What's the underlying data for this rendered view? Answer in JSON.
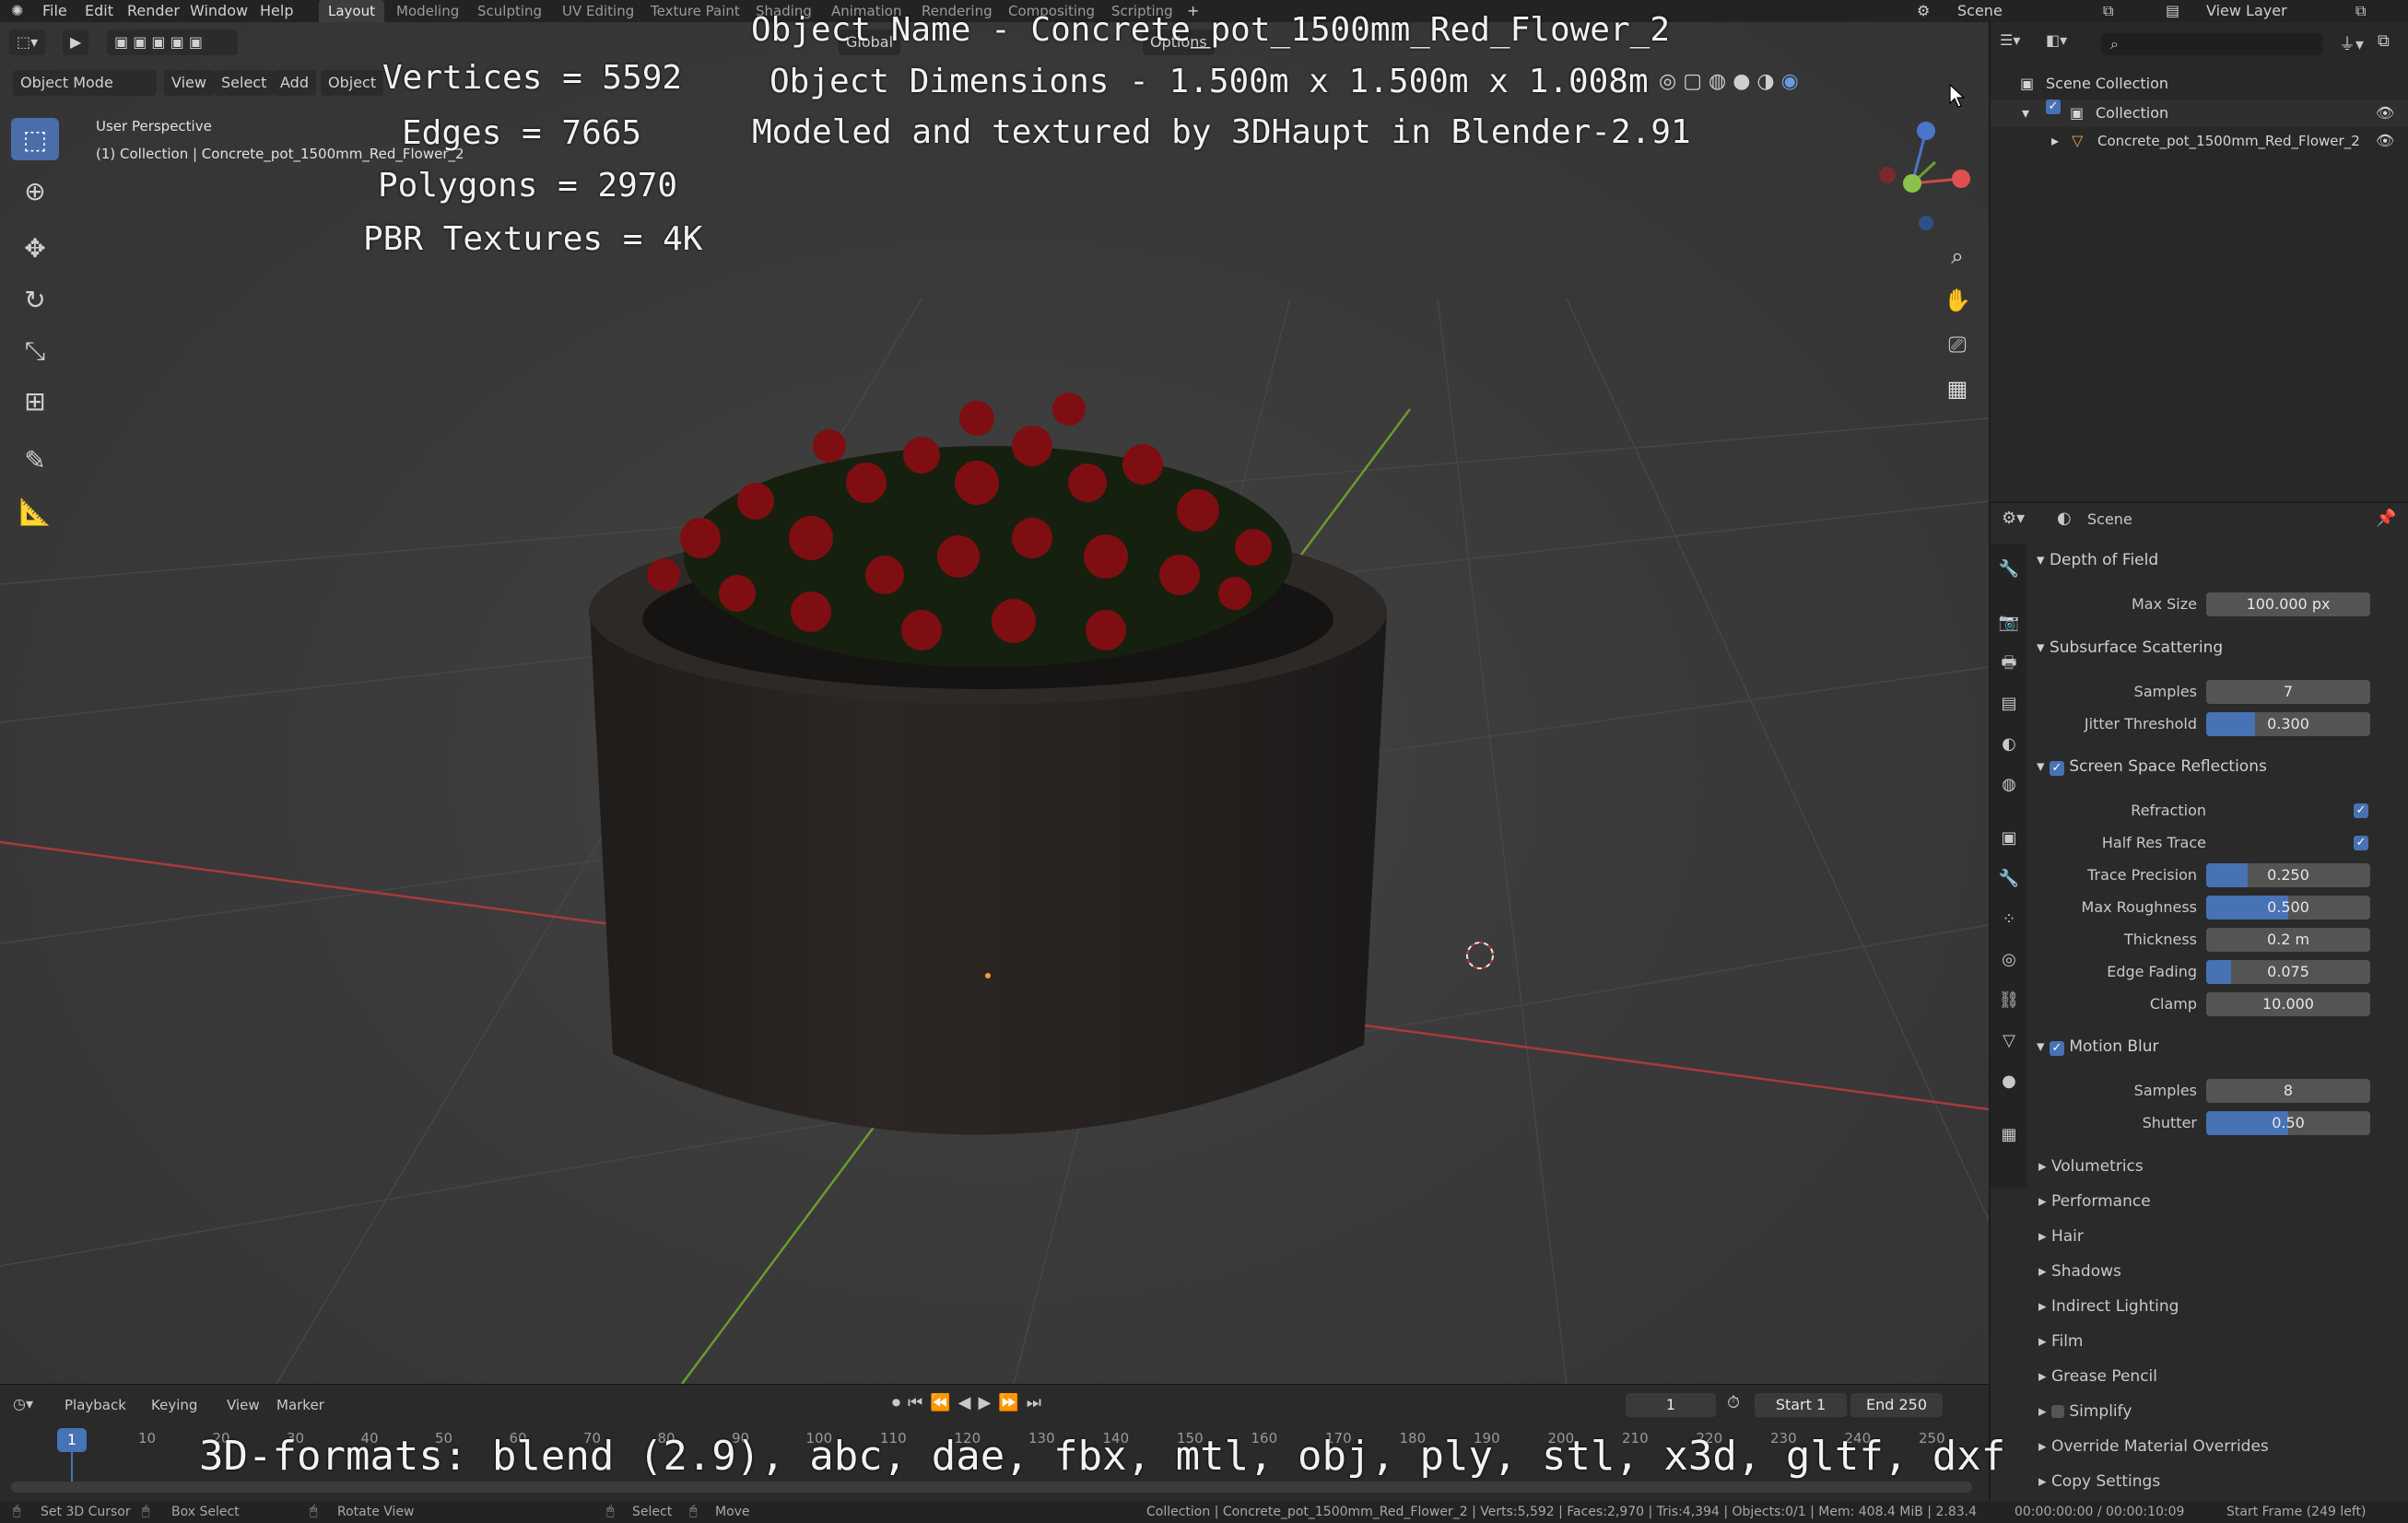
{
  "menu": [
    "File",
    "Edit",
    "Render",
    "Window",
    "Help"
  ],
  "workspaces": [
    "Layout",
    "Modeling",
    "Sculpting",
    "UV Editing",
    "Texture Paint",
    "Shading",
    "Animation",
    "Rendering",
    "Compositing",
    "Scripting"
  ],
  "scene_name": "Scene",
  "view_layer": "View Layer",
  "viewport": {
    "mode": "Object Mode",
    "header_menus": [
      "View",
      "Select",
      "Add",
      "Object"
    ],
    "orientation": "Global",
    "options_label": "Options",
    "perspective": "User Perspective",
    "collection_label": "(1) Collection | Concrete_pot_1500mm_Red_Flower_2"
  },
  "overlay": {
    "object_name": "Object Name - Concrete_pot_1500mm_Red_Flower_2",
    "dimensions": "Object Dimensions -  1.500m x 1.500m x 1.008m",
    "credit": "Modeled and textured by 3DHaupt in Blender-2.91",
    "vertices": "Vertices = 5592",
    "edges": "Edges = 7665",
    "polygons": "Polygons = 2970",
    "textures": "PBR Textures = 4K",
    "formats": "3D-formats: blend (2.9), abc, dae, fbx, mtl, obj, ply, stl, x3d, gltf, dxf"
  },
  "outliner": {
    "root": "Scene Collection",
    "collection": "Collection",
    "object": "Concrete_pot_1500mm_Red_Flower_2"
  },
  "properties": {
    "context": "Scene",
    "dof": {
      "title": "Depth of Field",
      "max_size_label": "Max Size",
      "max_size": "100.000 px"
    },
    "sss": {
      "title": "Subsurface Scattering",
      "samples_label": "Samples",
      "samples": "7",
      "jitter_label": "Jitter Threshold",
      "jitter": "0.300",
      "jitter_frac": 0.3
    },
    "ssr": {
      "title": "Screen Space Reflections",
      "refraction": "Refraction",
      "half_res": "Half Res Trace",
      "trace_label": "Trace Precision",
      "trace": "0.250",
      "trace_frac": 0.25,
      "rough_label": "Max Roughness",
      "rough": "0.500",
      "rough_frac": 0.5,
      "thick_label": "Thickness",
      "thick": "0.2 m",
      "fade_label": "Edge Fading",
      "fade": "0.075",
      "fade_frac": 0.15,
      "clamp_label": "Clamp",
      "clamp": "10.000"
    },
    "mblur": {
      "title": "Motion Blur",
      "samples_label": "Samples",
      "samples": "8",
      "shutter_label": "Shutter",
      "shutter": "0.50",
      "shutter_frac": 0.5
    },
    "collapsed": [
      "Volumetrics",
      "Performance",
      "Hair",
      "Shadows",
      "Indirect Lighting",
      "Film",
      "Grease Pencil",
      "Simplify",
      "Override Material Overrides",
      "Copy Settings"
    ]
  },
  "timeline": {
    "menus": [
      "Playback",
      "Keying",
      "View",
      "Marker"
    ],
    "current_frame": "1",
    "start_label": "Start",
    "start": "1",
    "end_label": "End",
    "end": "250",
    "ticks": [
      "10",
      "20",
      "30",
      "40",
      "50",
      "60",
      "70",
      "80",
      "90",
      "100",
      "110",
      "120",
      "130",
      "140",
      "150",
      "160",
      "170",
      "180",
      "190",
      "200",
      "210",
      "220",
      "230",
      "240",
      "250"
    ],
    "playhead": "1"
  },
  "statusbar": {
    "set_cursor": "Set 3D Cursor",
    "box_select": "Box Select",
    "rotate": "Rotate View",
    "select": "Select",
    "move": "Move",
    "info": "Collection | Concrete_pot_1500mm_Red_Flower_2 | Verts:5,592 | Faces:2,970 | Tris:4,394 | Objects:0/1 | Mem: 408.4 MiB | 2.83.4",
    "time": "00:00:00:00 / 00:00:10:09",
    "start_frame": "Start Frame (249 left)"
  },
  "colors": {
    "accent": "#4772b3",
    "x_axis": "#a83a3a",
    "y_axis": "#6b9a2e",
    "flower": "#8a0f14"
  }
}
